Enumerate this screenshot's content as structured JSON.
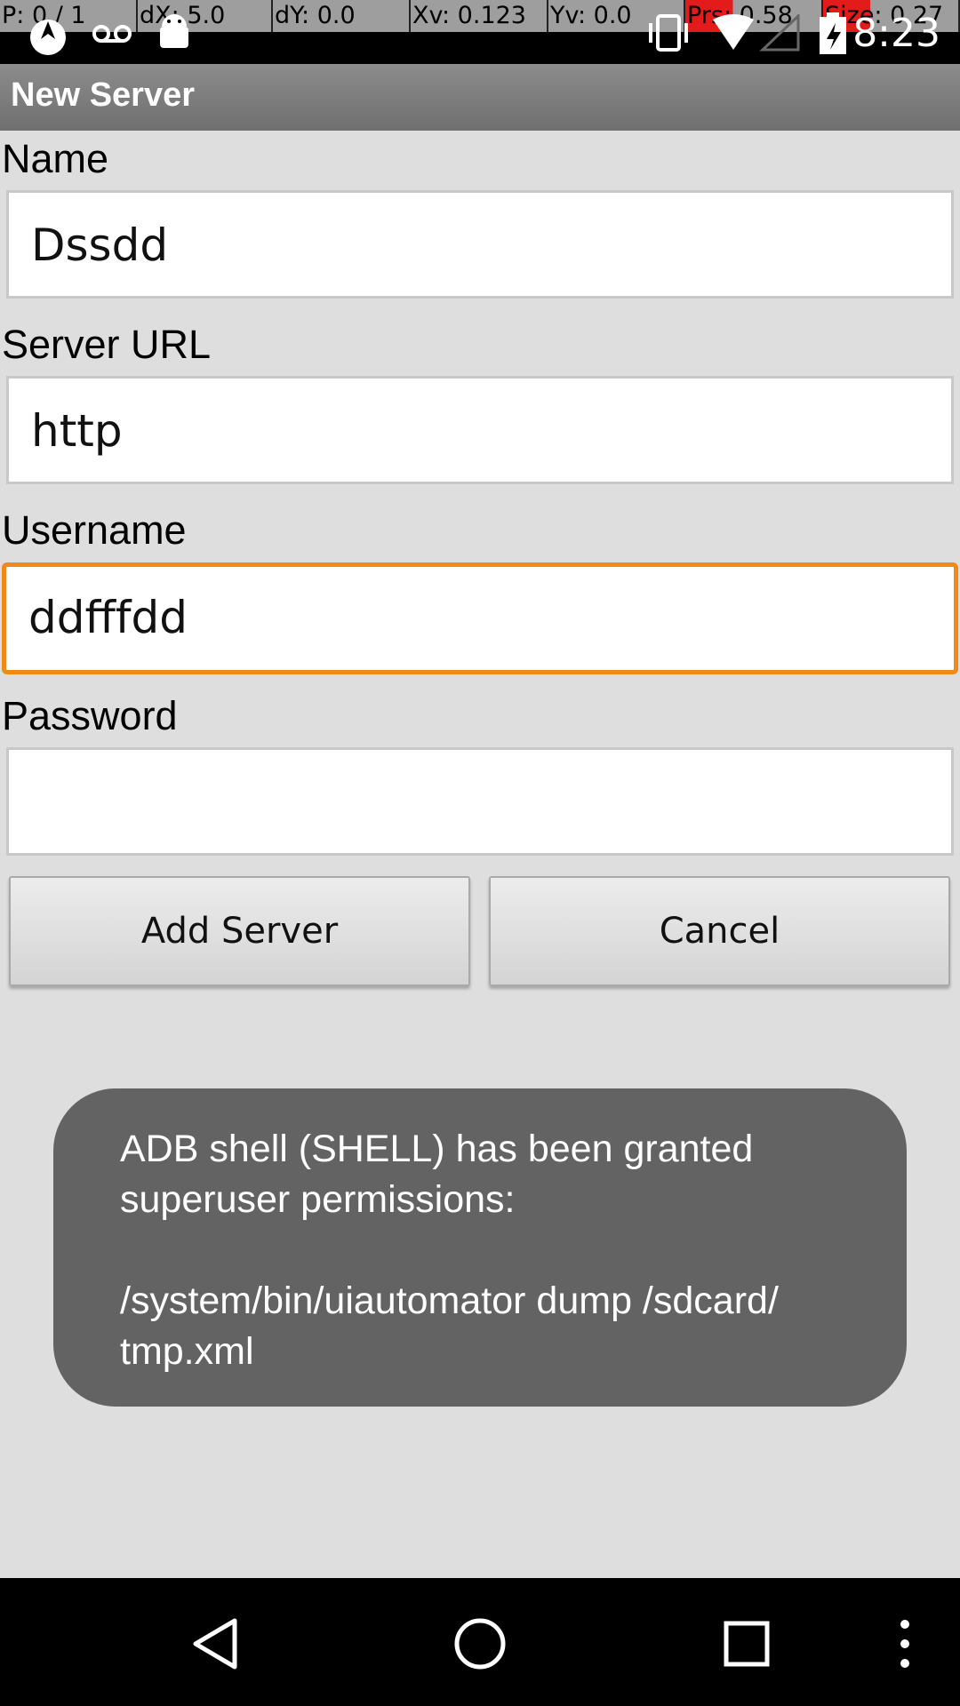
{
  "status_bar": {
    "debug_readouts": [
      "P: 0 / 1",
      "dX: 5.0",
      "dY: 0.0",
      "Xv: 0.123",
      "Yv: 0.0",
      "Prs: 0.58",
      "Size: 0.27"
    ],
    "time": "8:23",
    "icons": [
      "app-notification-icon",
      "voicemail-icon",
      "android-icon",
      "vibrate-icon",
      "wifi-icon",
      "signal-icon",
      "battery-icon"
    ]
  },
  "title_bar": {
    "title": "New Server"
  },
  "form": {
    "name_label": "Name",
    "name_value": "Dssdd",
    "url_label": "Server URL",
    "url_value": "http",
    "username_label": "Username",
    "username_value": "ddfffdd",
    "password_label": "Password",
    "password_value": ""
  },
  "buttons": {
    "add": "Add Server",
    "cancel": "Cancel"
  },
  "toast": {
    "message": "ADB shell (SHELL) has been granted\nsuperuser permissions:\n\n/system/bin/uiautomator dump /sdcard/\ntmp.xml"
  },
  "nav_bar": {
    "icons": [
      "back-icon",
      "home-icon",
      "recents-icon",
      "overflow-menu-icon"
    ]
  },
  "colors": {
    "focus_accent": "#f08a16",
    "toast_bg": "#636363",
    "title_bar": "#7f7f7f"
  }
}
